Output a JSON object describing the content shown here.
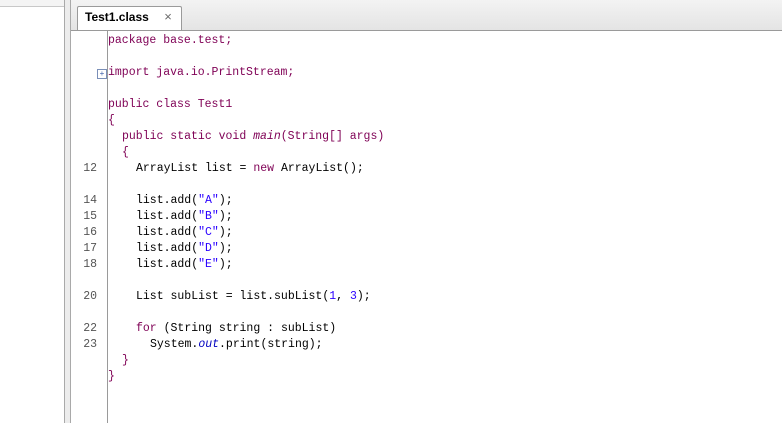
{
  "tab": {
    "title": "Test1.class",
    "close": "×"
  },
  "code": {
    "l1": "package base.test;",
    "l2": "import java.io.PrintStream;",
    "l3a": "public class ",
    "l3b": "Test1",
    "l4": "{",
    "l5a": "public static void ",
    "l5b": "main",
    "l5c": "(String[] args)",
    "l6": "{",
    "l7a": "ArrayList list = ",
    "l7b": "new",
    "l7c": " ArrayList();",
    "l8a": "list.add(",
    "l8b": "\"A\"",
    "l8c": ");",
    "l9a": "list.add(",
    "l9b": "\"B\"",
    "l9c": ");",
    "l10a": "list.add(",
    "l10b": "\"C\"",
    "l10c": ");",
    "l11a": "list.add(",
    "l11b": "\"D\"",
    "l11c": ");",
    "l12a": "list.add(",
    "l12b": "\"E\"",
    "l12c": ");",
    "l13a": "List subList = list.subList(",
    "l13b": "1",
    "l13c": ", ",
    "l13d": "3",
    "l13e": ");",
    "l14a": "for",
    "l14b": " (String string : subList)",
    "l15a": "System.",
    "l15b": "out",
    "l15c": ".print(string);",
    "l16": "}",
    "l17": "}"
  },
  "line_numbers": {
    "n12": "12",
    "n14": "14",
    "n15": "15",
    "n16": "16",
    "n17": "17",
    "n18": "18",
    "n20": "20",
    "n22": "22",
    "n23": "23"
  },
  "fold_marker": "+"
}
